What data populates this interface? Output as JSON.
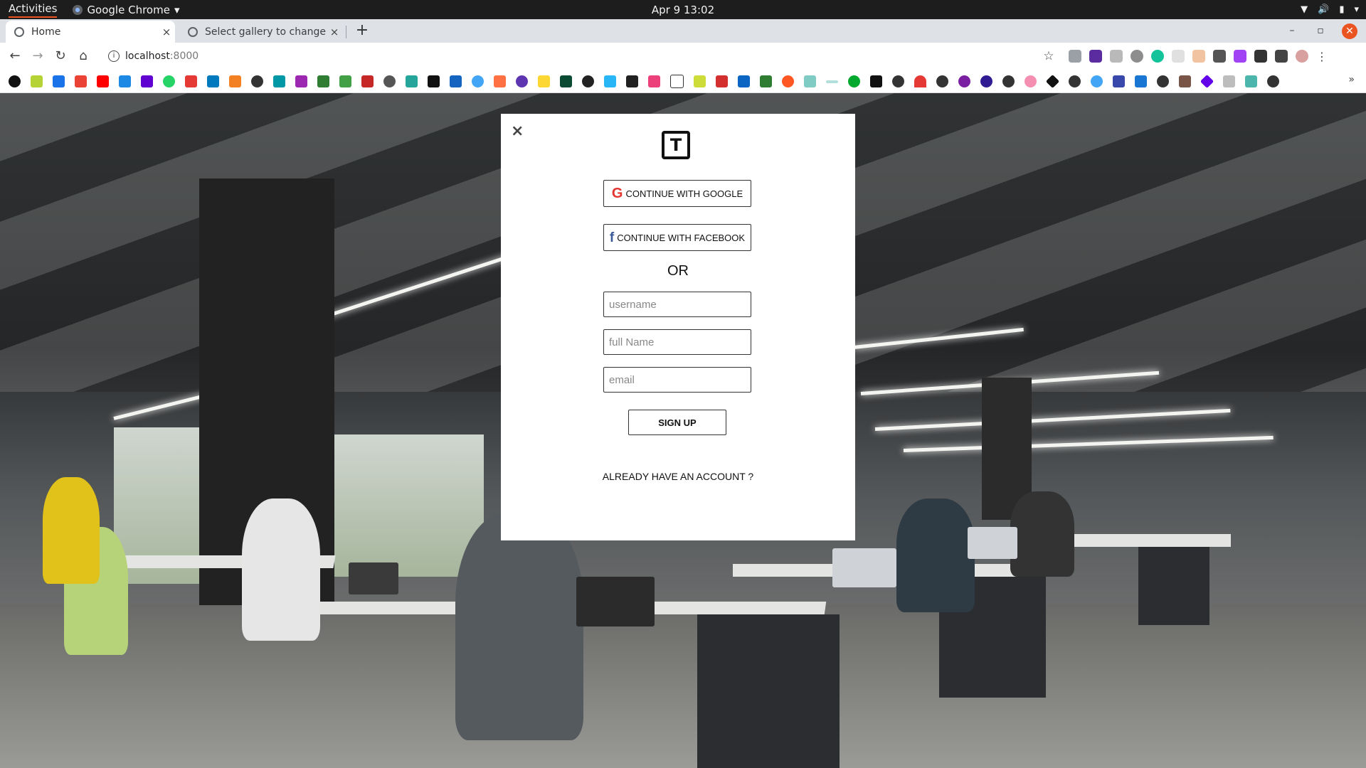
{
  "topbar": {
    "activities": "Activities",
    "app_name": "Google Chrome",
    "clock": "Apr 9  13:02"
  },
  "tabs": [
    {
      "label": "Home",
      "close": "×"
    },
    {
      "label": "Select gallery to change | ",
      "close": "×"
    }
  ],
  "tabstrip": {
    "new_tab": "+"
  },
  "toolbar": {
    "url_host": "localhost",
    "url_port": ":8000"
  },
  "bookmarks": {
    "more": "»"
  },
  "modal": {
    "close": "×",
    "logo_letter": "T",
    "google_label": "CONTINUE WITH GOOGLE",
    "google_icon": "G",
    "facebook_label": "CONTINUE WITH FACEBOOK",
    "facebook_icon": "f",
    "or_text": "OR",
    "username_placeholder": "username",
    "fullname_placeholder": "full Name",
    "email_placeholder": "email",
    "signup_label": "SIGN UP",
    "already_label": "ALREADY HAVE AN ACCOUNT ?"
  },
  "colors": {
    "google_red": "#e3342f",
    "facebook_blue": "#3b5998",
    "ubuntu_orange": "#e95420"
  }
}
